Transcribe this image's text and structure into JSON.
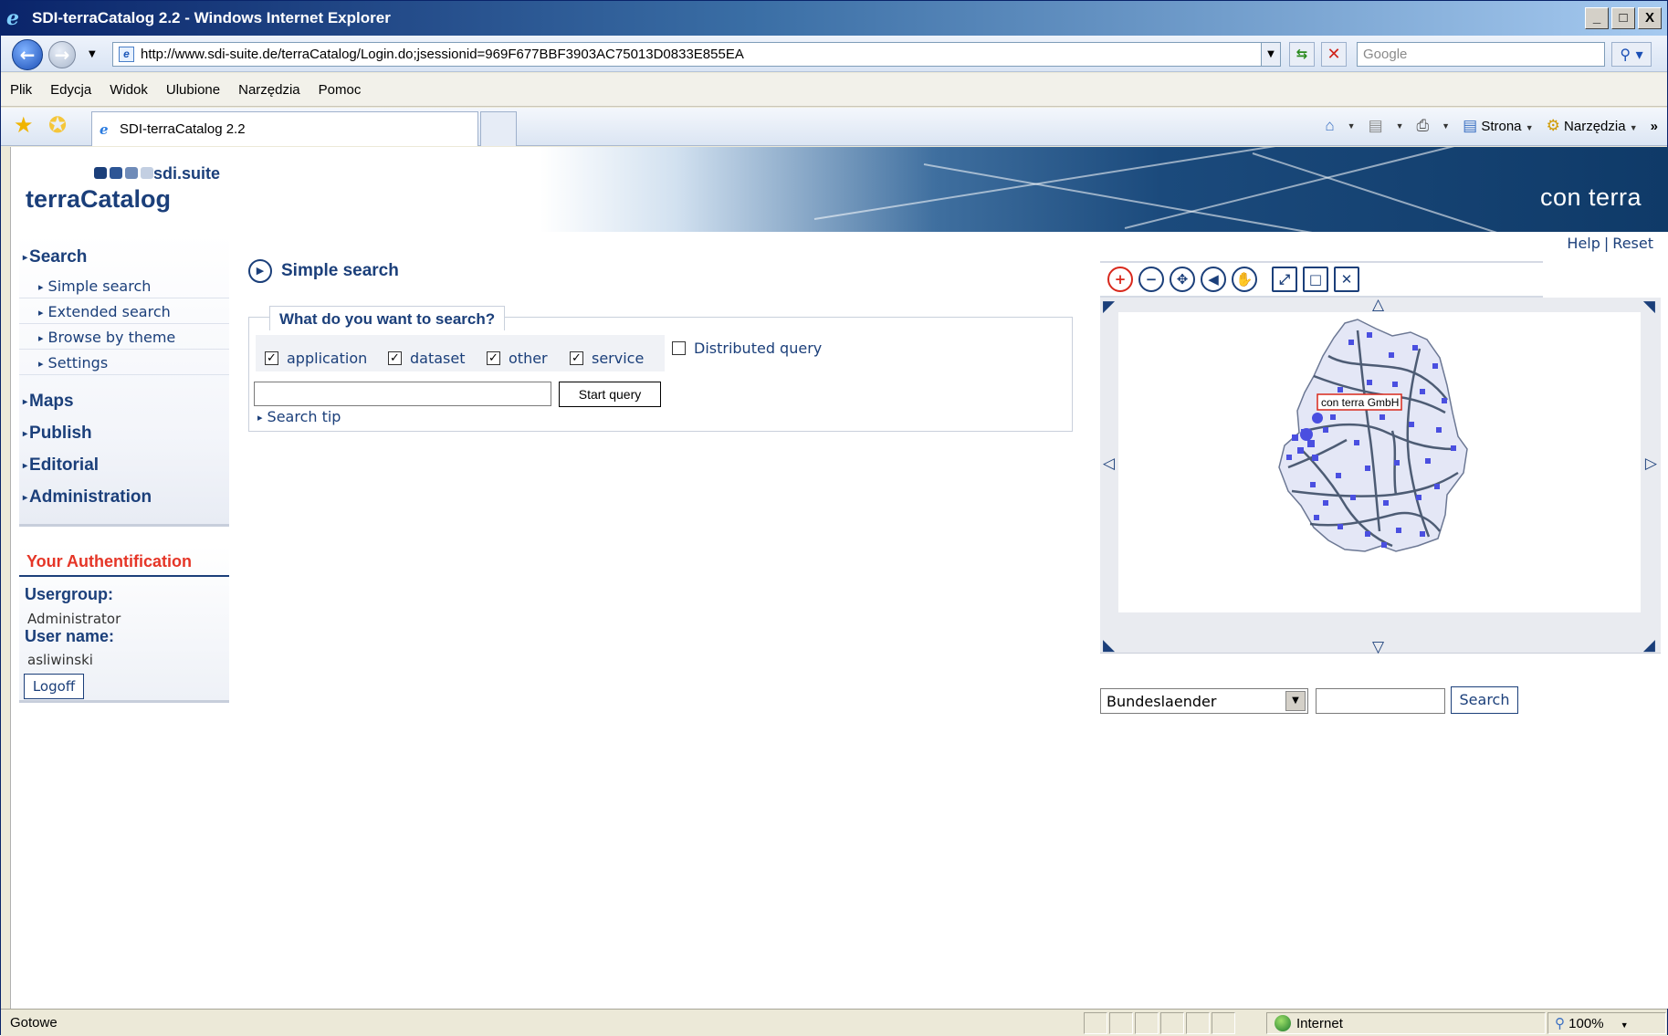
{
  "window": {
    "title": "SDI-terraCatalog 2.2 - Windows Internet Explorer",
    "buttons": {
      "minimize": "_",
      "maximize": "□",
      "close": "X"
    }
  },
  "address": {
    "url": "http://www.sdi-suite.de/terraCatalog/Login.do;jsessionid=969F677BBF3903AC75013D0833E855EA",
    "search_placeholder": "Google"
  },
  "menu": [
    "Plik",
    "Edycja",
    "Widok",
    "Ulubione",
    "Narzędzia",
    "Pomoc"
  ],
  "tab": {
    "label": "SDI-terraCatalog 2.2"
  },
  "commandbar": {
    "page": "Strona",
    "tools": "Narzędzia"
  },
  "brand": {
    "suite": "sdi.suite",
    "product": "terraCatalog",
    "company": "con terra",
    "square_colors": [
      "#1b3f7a",
      "#2d5595",
      "#6f8bb8",
      "#c3cfe2"
    ]
  },
  "header_links": {
    "help": "Help",
    "separator": "|",
    "reset": "Reset"
  },
  "nav": {
    "search": "Search",
    "search_items": [
      "Simple search",
      "Extended search",
      "Browse by theme",
      "Settings"
    ],
    "maps": "Maps",
    "publish": "Publish",
    "editorial": "Editorial",
    "administration": "Administration"
  },
  "auth": {
    "title": "Your Authentification",
    "usergroup_label": "Usergroup:",
    "usergroup": "Administrator",
    "username_label": "User name:",
    "username": "asliwinski",
    "logoff": "Logoff"
  },
  "search": {
    "heading": "Simple search",
    "legend": "What do you want to search?",
    "types": [
      {
        "label": "application",
        "checked": true
      },
      {
        "label": "dataset",
        "checked": true
      },
      {
        "label": "other",
        "checked": true
      },
      {
        "label": "service",
        "checked": true
      }
    ],
    "distributed": {
      "label": "Distributed query",
      "checked": false
    },
    "query_value": "",
    "start_button": "Start query",
    "tip": "Search tip"
  },
  "map": {
    "tools": [
      "zoom-in-icon",
      "zoom-out-icon",
      "pan-icon",
      "back-icon",
      "hand-icon",
      "zoom-extent-icon",
      "zoom-box-icon",
      "clear-icon"
    ],
    "marker_label": "con terra GmbH",
    "layer_select": "Bundeslaender",
    "search_value": "",
    "search_button": "Search",
    "colors": {
      "land": "#e4e7f6",
      "roads": "#3d4d66",
      "points": "#4a4fe0"
    }
  },
  "statusbar": {
    "text": "Gotowe",
    "zone": "Internet",
    "zoom": "100%"
  }
}
